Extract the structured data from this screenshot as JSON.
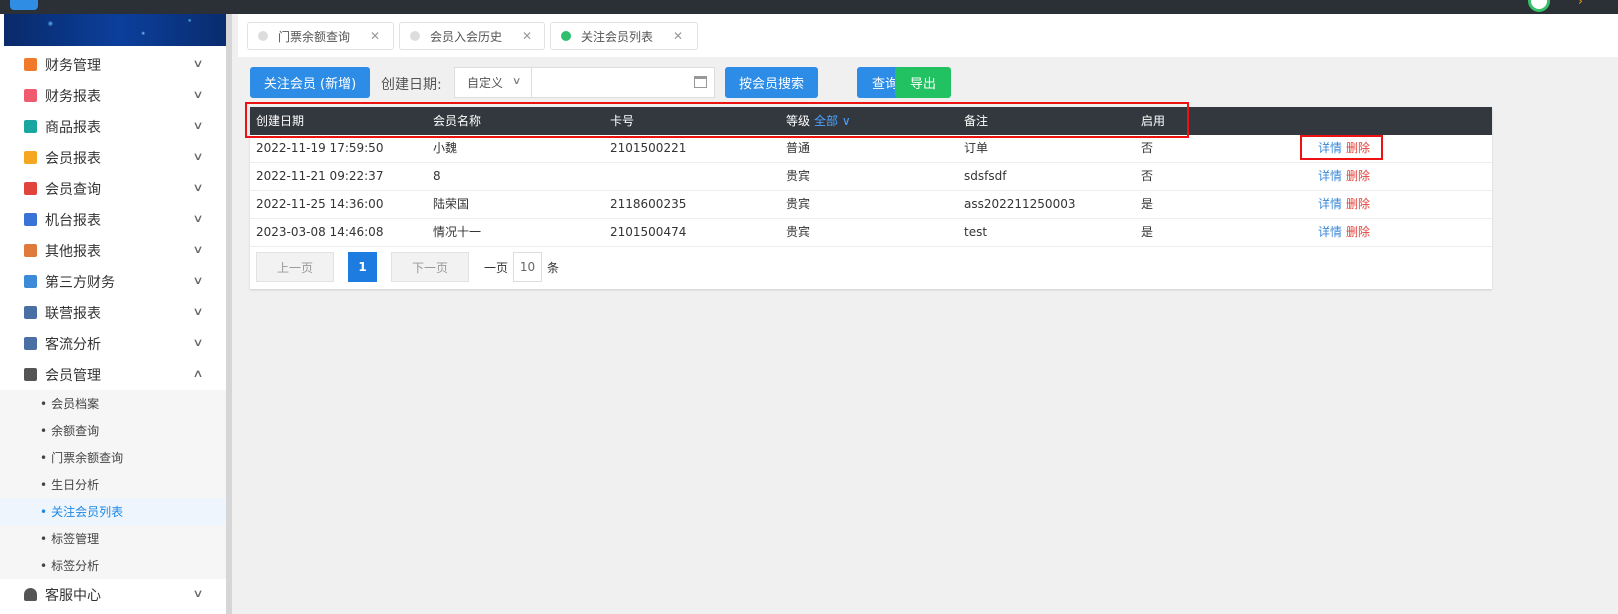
{
  "sidebar": {
    "items": [
      {
        "label": "财务管理",
        "icon": "ledger-icon",
        "color": "#f07a2a"
      },
      {
        "label": "财务报表",
        "icon": "report-icon",
        "color": "#ef5a6e"
      },
      {
        "label": "商品报表",
        "icon": "goods-icon",
        "color": "#1aa6a0"
      },
      {
        "label": "会员报表",
        "icon": "member-report-icon",
        "color": "#f5a623"
      },
      {
        "label": "会员查询",
        "icon": "member-query-icon",
        "color": "#e0443c"
      },
      {
        "label": "机台报表",
        "icon": "machine-icon",
        "color": "#3a73d6"
      },
      {
        "label": "其他报表",
        "icon": "layers-icon",
        "color": "#e07a3a"
      },
      {
        "label": "第三方财务",
        "icon": "calculator-icon",
        "color": "#3c8ad8"
      },
      {
        "label": "联营报表",
        "icon": "partners-icon",
        "color": "#4a6fa5"
      },
      {
        "label": "客流分析",
        "icon": "target-icon",
        "color": "#4a6fa5"
      },
      {
        "label": "会员管理",
        "icon": "user-icon",
        "color": "#555555"
      }
    ],
    "member_mgmt_sub": [
      {
        "label": "会员档案"
      },
      {
        "label": "余额查询"
      },
      {
        "label": "门票余额查询"
      },
      {
        "label": "生日分析"
      },
      {
        "label": "关注会员列表"
      },
      {
        "label": "标签管理"
      },
      {
        "label": "标签分析"
      }
    ],
    "service": {
      "label": "客服中心",
      "icon": "headset-icon"
    },
    "bullet": "•",
    "chevron_down": "∨",
    "chevron_up": "∧"
  },
  "tabs": [
    {
      "label": "门票余额查询",
      "close": "✕"
    },
    {
      "label": "会员入会历史",
      "close": "✕"
    },
    {
      "label": "关注会员列表",
      "close": "✕"
    }
  ],
  "toolbar": {
    "add_label": "关注会员 (新增)",
    "date_label": "创建日期:",
    "date_mode": "自定义",
    "date_value": "",
    "search_member_label": "按会员搜索",
    "query_label": "查询",
    "export_label": "导出"
  },
  "table": {
    "headers": {
      "created": "创建日期",
      "name": "会员名称",
      "card": "卡号",
      "grade": "等级",
      "grade_filter": "全部 ∨",
      "remark": "备注",
      "enabled": "启用"
    },
    "rows": [
      {
        "created": "2022-11-19 17:59:50",
        "name": "小魏",
        "card": "2101500221",
        "grade": "普通",
        "remark": "订单",
        "enabled": "否"
      },
      {
        "created": "2022-11-21 09:22:37",
        "name": "8",
        "card": "",
        "grade": "贵宾",
        "remark": "sdsfsdf",
        "enabled": "否"
      },
      {
        "created": "2022-11-25 14:36:00",
        "name": "陆荣国",
        "card": "2118600235",
        "grade": "贵宾",
        "remark": "ass202211250003",
        "enabled": "是"
      },
      {
        "created": "2023-03-08 14:46:08",
        "name": "情况十一",
        "card": "2101500474",
        "grade": "贵宾",
        "remark": "test",
        "enabled": "是"
      }
    ],
    "actions": {
      "detail": "详情",
      "delete": "删除"
    }
  },
  "pager": {
    "prev": "上一页",
    "current": "1",
    "next": "下一页",
    "per_page_prefix": "一页",
    "per_page": "10",
    "per_page_suffix": "条"
  },
  "colors": {
    "accent_blue": "#2d8ce6",
    "export_green": "#22c162",
    "active_tab_dot": "#2dbf6c",
    "highlight_red": "#e11111"
  }
}
